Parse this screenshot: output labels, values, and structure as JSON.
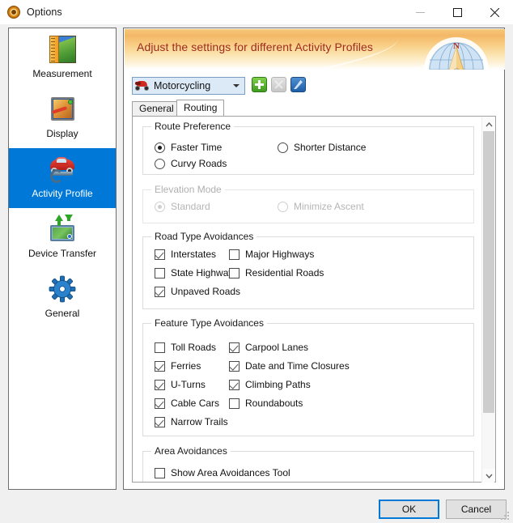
{
  "window": {
    "title": "Options",
    "title_icon": "compass-icon",
    "controls": {
      "minimize": "minimize-icon",
      "maximize": "maximize-icon",
      "close": "close-icon"
    }
  },
  "sidebar": {
    "items": [
      {
        "label": "Measurement",
        "icon": "ruler-map-icon",
        "selected": false
      },
      {
        "label": "Display",
        "icon": "picture-map-icon",
        "selected": false
      },
      {
        "label": "Activity Profile",
        "icon": "car-wrench-icon",
        "selected": true
      },
      {
        "label": "Device Transfer",
        "icon": "laptop-transfer-icon",
        "selected": false
      },
      {
        "label": "General",
        "icon": "gear-icon",
        "selected": false
      }
    ]
  },
  "banner": {
    "text": "Adjust the settings for different Activity Profiles",
    "graphic": "compass-rose-graphic",
    "compass_north_label": "N",
    "text_color": "#9e2a1f"
  },
  "profile": {
    "selected": "Motorcycling",
    "icon": "motorcycle-icon",
    "buttons": {
      "add": "+",
      "delete": "×",
      "edit": "pencil-icon"
    }
  },
  "tabs": [
    {
      "label": "General",
      "selected": false
    },
    {
      "label": "Routing",
      "selected": true
    }
  ],
  "groups": {
    "route_preference": {
      "title": "Route Preference",
      "disabled": false,
      "options": [
        {
          "label": "Faster Time",
          "selected": true
        },
        {
          "label": "Shorter Distance",
          "selected": false
        },
        {
          "label": "Curvy Roads",
          "selected": false
        }
      ]
    },
    "elevation_mode": {
      "title": "Elevation Mode",
      "disabled": true,
      "options": [
        {
          "label": "Standard",
          "selected": true
        },
        {
          "label": "Minimize Ascent",
          "selected": false
        }
      ]
    },
    "road_type_avoidances": {
      "title": "Road Type Avoidances",
      "options": [
        {
          "label": "Interstates",
          "checked": true
        },
        {
          "label": "Major Highways",
          "checked": false
        },
        {
          "label": "State Highways",
          "checked": false
        },
        {
          "label": "Residential Roads",
          "checked": false
        },
        {
          "label": "Unpaved Roads",
          "checked": true
        }
      ]
    },
    "feature_type_avoidances": {
      "title": "Feature Type Avoidances",
      "options": [
        {
          "label": "Toll Roads",
          "checked": false
        },
        {
          "label": "Carpool Lanes",
          "checked": true
        },
        {
          "label": "Ferries",
          "checked": true
        },
        {
          "label": "Date and Time Closures",
          "checked": true
        },
        {
          "label": "U-Turns",
          "checked": true
        },
        {
          "label": "Climbing Paths",
          "checked": true
        },
        {
          "label": "Cable Cars",
          "checked": true
        },
        {
          "label": "Roundabouts",
          "checked": false
        },
        {
          "label": "Narrow Trails",
          "checked": true
        }
      ]
    },
    "area_avoidances": {
      "title": "Area Avoidances",
      "options": [
        {
          "label": "Show Area Avoidances Tool",
          "checked": false
        }
      ]
    }
  },
  "scrollbar": {
    "up_arrow": "chevron-up-icon",
    "down_arrow": "chevron-down-icon"
  },
  "footer": {
    "ok": "OK",
    "cancel": "Cancel",
    "accent": "#0078d7"
  }
}
